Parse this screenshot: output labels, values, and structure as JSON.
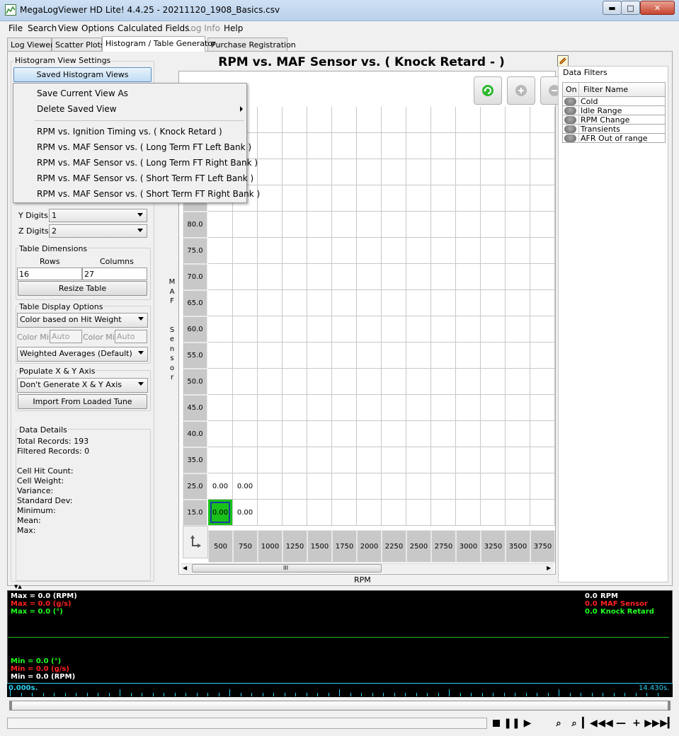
{
  "window": {
    "title": "MegaLogViewer HD Lite! 4.4.25 - 20211120_1908_Basics.csv"
  },
  "menu": [
    "File",
    "Search",
    "View",
    "Options",
    "Calculated Fields",
    "Log Info",
    "Help"
  ],
  "menu_disabled": "Log Info",
  "tabs": [
    "Log Viewer",
    "Scatter Plots",
    "Histogram / Table Generator",
    "Purchase Registration"
  ],
  "left": {
    "section_title": "Histogram View Settings",
    "saved_views_button": "Saved Histogram Views",
    "y_digits_label": "Y Digits:",
    "y_digits_value": "1",
    "z_digits_label": "Z Digits:",
    "z_digits_value": "2",
    "table_dimensions_title": "Table Dimensions",
    "rows_label": "Rows",
    "columns_label": "Columns",
    "rows_value": "16",
    "columns_value": "27",
    "resize_button": "Resize Table",
    "display_options_title": "Table Display Options",
    "color_mode": "Color based on Hit Weight",
    "color_min_label": "Color Min",
    "color_max_label": "Color Min",
    "color_min_placeholder": "Auto",
    "color_max_placeholder": "Auto",
    "average_mode": "Weighted Averages (Default)",
    "populate_title": "Populate X & Y Axis",
    "populate_mode": "Don't Generate X & Y Axis",
    "import_button": "Import From Loaded Tune",
    "data_details_title": "Data Details",
    "total_records": "Total Records: 193",
    "filtered_records": "Filtered Records: 0",
    "cell_hit_count": "Cell Hit Count:",
    "cell_weight": "Cell Weight:",
    "variance": "Variance:",
    "std_dev": "Standard Dev:",
    "minimum": "Minimum:",
    "mean": "Mean:",
    "max": "Max:"
  },
  "popup": {
    "items": [
      "Save Current View As",
      "Delete Saved View",
      "RPM vs. Ignition Timing vs. ( Knock Retard )",
      "RPM vs. MAF Sensor vs. ( Long Term FT Left Bank )",
      "RPM vs. MAF Sensor vs. ( Long Term FT Right Bank )",
      "RPM vs. MAF Sensor vs. ( Short Term FT Left Bank )",
      "RPM vs. MAF Sensor vs. ( Short Term FT Right Bank )"
    ]
  },
  "table": {
    "title": "RPM vs. MAF Sensor vs. ( Knock Retard -   )",
    "y_axis_label": "MAF Sensor",
    "x_axis_label": "RPM",
    "y_values": [
      "80.0",
      "75.0",
      "70.0",
      "65.0",
      "60.0",
      "55.0",
      "50.0",
      "45.0",
      "40.0",
      "35.0",
      "25.0",
      "15.0"
    ],
    "x_values": [
      "500",
      "750",
      "1000",
      "1250",
      "1500",
      "1750",
      "2000",
      "2250",
      "2500",
      "2750",
      "3000",
      "3250",
      "3500",
      "3750"
    ],
    "filled": [
      {
        "row": "25.0",
        "col": "500",
        "value": "0.00"
      },
      {
        "row": "25.0",
        "col": "750",
        "value": "0.00"
      },
      {
        "row": "15.0",
        "col": "500",
        "value": "0.00",
        "highlight": "#19c219"
      },
      {
        "row": "15.0",
        "col": "750",
        "value": "0.00"
      }
    ],
    "scroll_grip": "III"
  },
  "filters": {
    "title": "Data Filters",
    "col_on": "On",
    "col_name": "Filter Name",
    "items": [
      "Cold",
      "Idle Range",
      "RPM Change",
      "Transients",
      "AFR Out of range"
    ]
  },
  "graph": {
    "left_top": [
      {
        "text": "Max = 0.0 (RPM)",
        "color": "#ffffff"
      },
      {
        "text": "Max = 0.0 (g/s)",
        "color": "#ff2020"
      },
      {
        "text": "Max = 0.0 (°)",
        "color": "#20ff20"
      }
    ],
    "left_bottom": [
      {
        "text": "Min = 0.0 (°)",
        "color": "#20ff20"
      },
      {
        "text": "Min = 0.0 (g/s)",
        "color": "#ff2020"
      },
      {
        "text": "Min = 0.0 (RPM)",
        "color": "#ffffff"
      }
    ],
    "right": [
      {
        "value": "0.0",
        "name": "RPM",
        "color": "#ffffff"
      },
      {
        "value": "0.0",
        "name": "MAF Sensor",
        "color": "#ff2020"
      },
      {
        "value": "0.0",
        "name": "Knock Retard",
        "color": "#20ff20"
      }
    ],
    "time_start": "0.000s.",
    "time_end": "14.430s."
  },
  "colors": {
    "accent": "#2ad0f0",
    "graph_line": "#20c020"
  }
}
